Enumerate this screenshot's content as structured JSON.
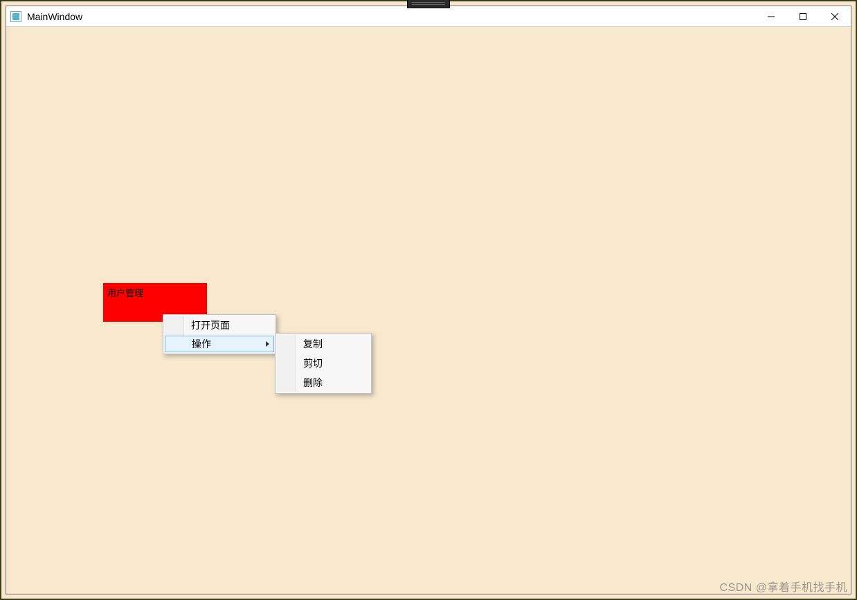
{
  "window": {
    "title": "MainWindow"
  },
  "panel": {
    "label": "用户管理"
  },
  "context_menu": {
    "items": [
      {
        "label": "打开页面"
      },
      {
        "label": "操作"
      }
    ],
    "submenu": {
      "items": [
        {
          "label": "复制"
        },
        {
          "label": "剪切"
        },
        {
          "label": "删除"
        }
      ]
    }
  },
  "watermark": "CSDN @拿着手机找手机"
}
